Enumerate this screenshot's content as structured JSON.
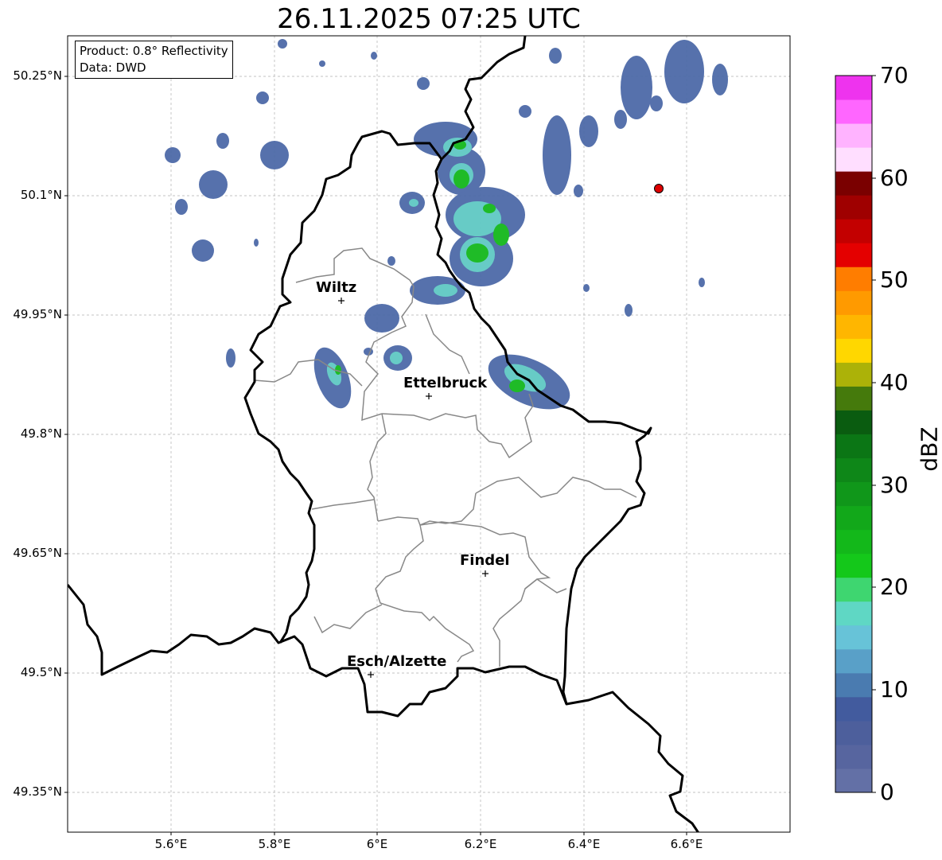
{
  "title": "26.11.2025 07:25 UTC",
  "info": {
    "product": "Product: 0.8° Reflectivity",
    "source": "Data: DWD"
  },
  "cities": [
    {
      "name": "Wiltz",
      "lon": 5.933,
      "lat": 49.966
    },
    {
      "name": "Ettelbruck",
      "lon": 6.103,
      "lat": 49.849
    },
    {
      "name": "Findel",
      "lon": 6.211,
      "lat": 49.626
    },
    {
      "name": "Esch/Alzette",
      "lon": 5.98,
      "lat": 49.496
    }
  ],
  "marker": {
    "lon": 6.55,
    "lat": 50.11,
    "color": "#dd0000"
  },
  "axes": {
    "lon_ticks": [
      "5.6°E",
      "5.8°E",
      "6°E",
      "6.2°E",
      "6.4°E",
      "6.6°E"
    ],
    "lat_ticks": [
      "50.25°N",
      "50.1°N",
      "49.95°N",
      "49.8°N",
      "49.65°N",
      "49.5°N",
      "49.35°N"
    ],
    "lon_range": [
      5.4,
      6.8
    ],
    "lat_range": [
      49.3,
      50.3
    ]
  },
  "colorbar": {
    "label": "dBZ",
    "ticks": [
      "0",
      "10",
      "20",
      "30",
      "40",
      "50",
      "60",
      "70"
    ],
    "range": [
      0,
      70
    ],
    "colors": [
      "#6370a6",
      "#57659f",
      "#4d5f9c",
      "#425b9e",
      "#4a7bb0",
      "#59a0c8",
      "#67c3d8",
      "#5fd7c4",
      "#3ed670",
      "#14c81a",
      "#13b81a",
      "#12a81a",
      "#10971a",
      "#0e8718",
      "#0b7615",
      "#0a5c10",
      "#457a0c",
      "#acb208",
      "#ffd700",
      "#ffb600",
      "#ff9a00",
      "#ff7d00",
      "#e40000",
      "#c30000",
      "#9f0000",
      "#7a0000",
      "#ffdeff",
      "#ffb3ff",
      "#ff66ff",
      "#ee33ee"
    ]
  }
}
